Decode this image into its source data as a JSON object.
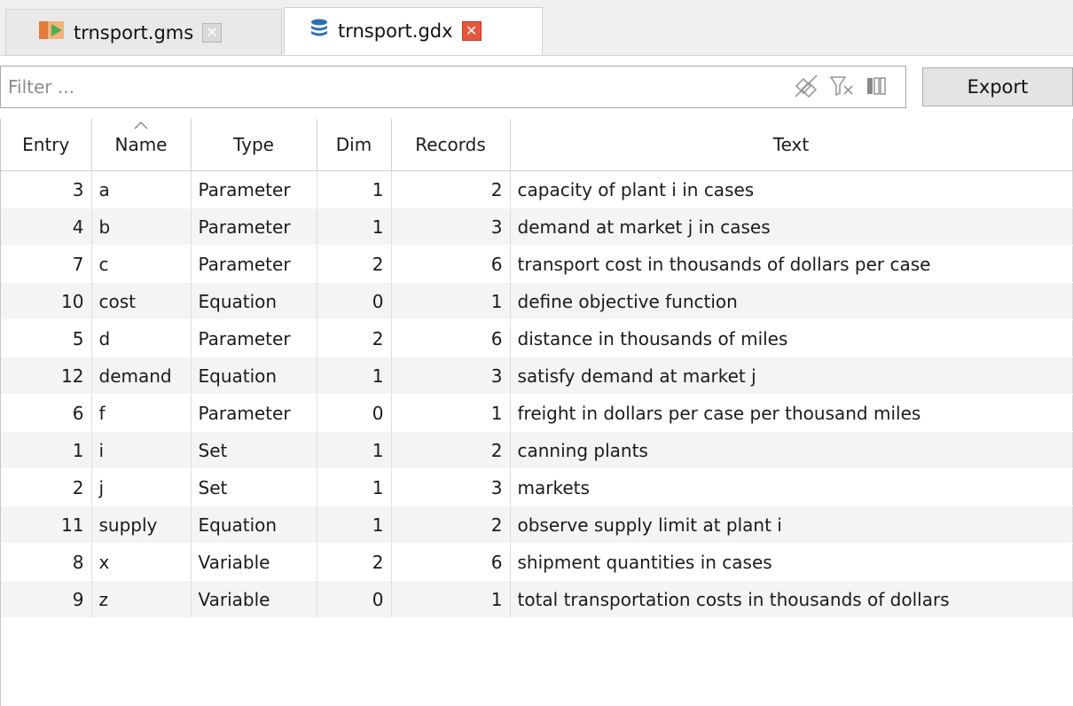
{
  "tabs": [
    {
      "label": "trnsport.gms",
      "close_glyph": "✕",
      "icon": "gams-model-icon",
      "active": false
    },
    {
      "label": "trnsport.gdx",
      "close_glyph": "✕",
      "icon": "database-icon",
      "active": true
    }
  ],
  "filter": {
    "placeholder": "Filter ...",
    "value": "",
    "tools": [
      "hide-empty-icon",
      "clear-filter-icon",
      "column-toggle-icon"
    ]
  },
  "export_label": "Export",
  "colors": {
    "active_close": "#e8563c",
    "db_icon": "#2c6fb7",
    "row_alt": "#f4f4f4"
  },
  "table": {
    "sorted_column": "Name",
    "columns": [
      "Entry",
      "Name",
      "Type",
      "Dim",
      "Records",
      "Text"
    ],
    "rows": [
      [
        "3",
        "a",
        "Parameter",
        "1",
        "2",
        "capacity of plant i in cases"
      ],
      [
        "4",
        "b",
        "Parameter",
        "1",
        "3",
        "demand at market j in cases"
      ],
      [
        "7",
        "c",
        "Parameter",
        "2",
        "6",
        "transport cost in thousands of dollars per case"
      ],
      [
        "10",
        "cost",
        "Equation",
        "0",
        "1",
        "define objective function"
      ],
      [
        "5",
        "d",
        "Parameter",
        "2",
        "6",
        "distance in thousands of miles"
      ],
      [
        "12",
        "demand",
        "Equation",
        "1",
        "3",
        "satisfy demand at market j"
      ],
      [
        "6",
        "f",
        "Parameter",
        "0",
        "1",
        "freight in dollars per case per thousand miles"
      ],
      [
        "1",
        "i",
        "Set",
        "1",
        "2",
        "canning plants"
      ],
      [
        "2",
        "j",
        "Set",
        "1",
        "3",
        "markets"
      ],
      [
        "11",
        "supply",
        "Equation",
        "1",
        "2",
        "observe supply limit at plant i"
      ],
      [
        "8",
        "x",
        "Variable",
        "2",
        "6",
        "shipment quantities in cases"
      ],
      [
        "9",
        "z",
        "Variable",
        "0",
        "1",
        "total transportation costs in thousands of dollars"
      ]
    ]
  }
}
